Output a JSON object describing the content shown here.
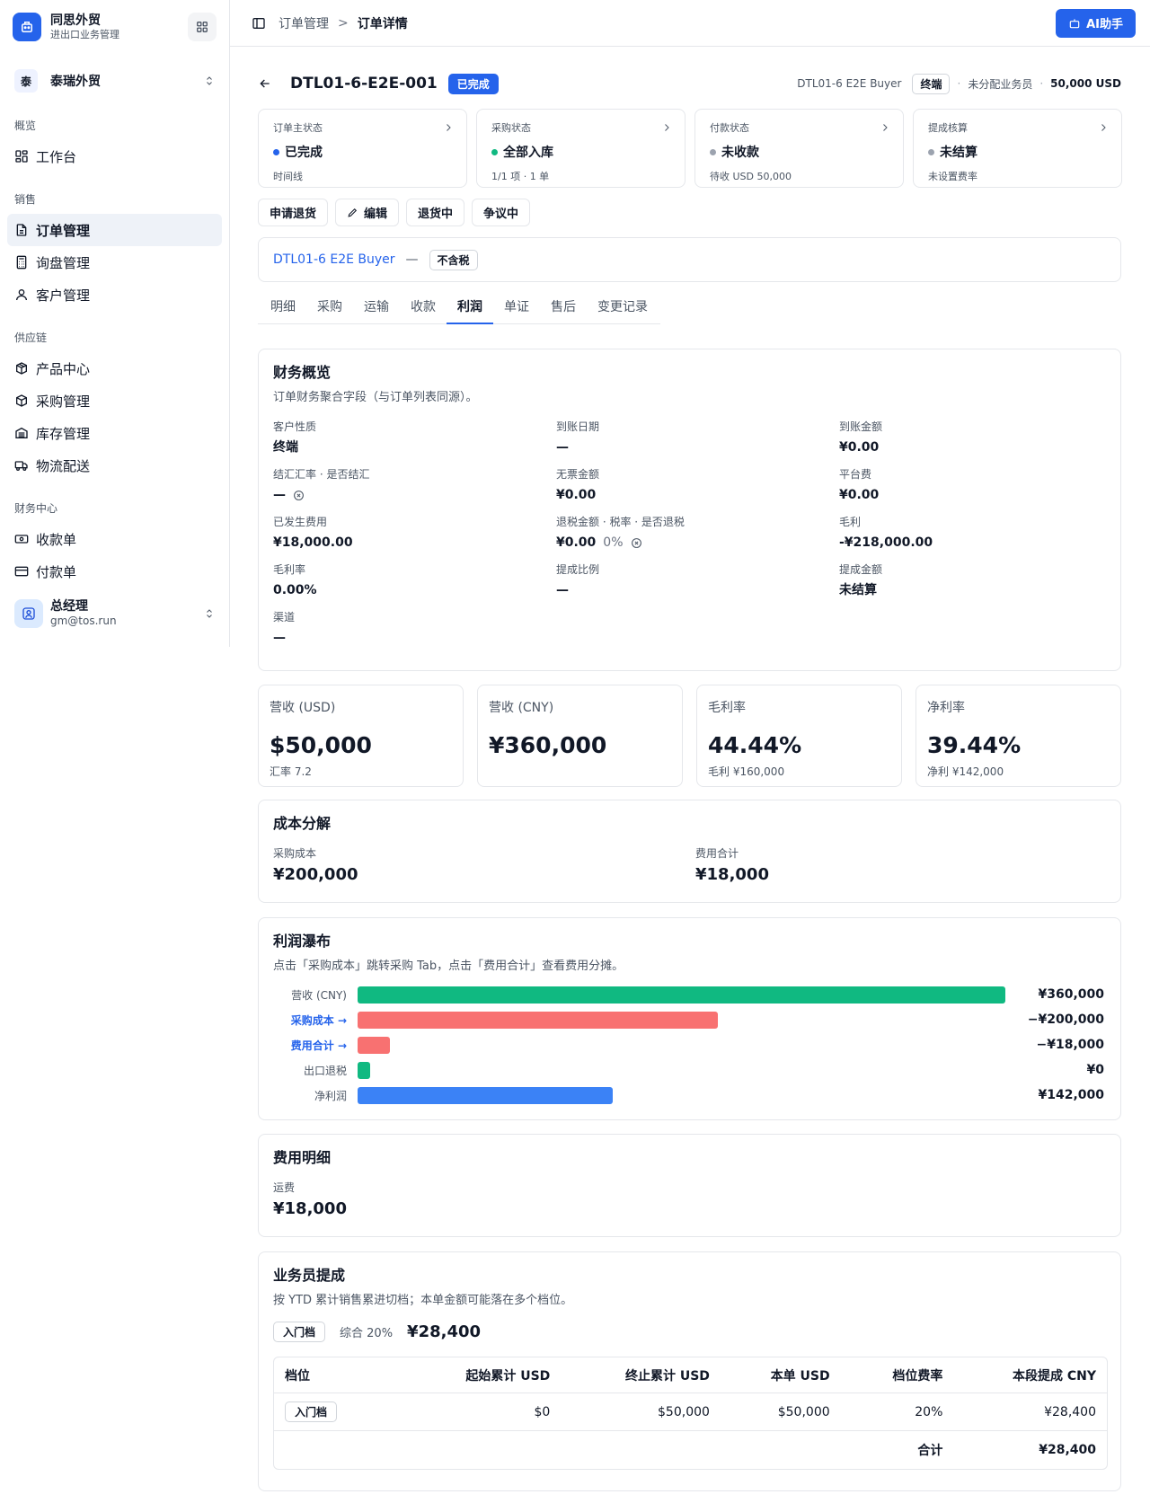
{
  "brand": {
    "name": "同思外贸",
    "subtitle": "进出口业务管理"
  },
  "org": {
    "badge": "泰",
    "name": "泰瑞外贸"
  },
  "nav": {
    "overview": {
      "label": "概览",
      "items": [
        {
          "label": "工作台"
        }
      ]
    },
    "sales": {
      "label": "销售",
      "items": [
        {
          "label": "订单管理"
        },
        {
          "label": "询盘管理"
        },
        {
          "label": "客户管理"
        }
      ]
    },
    "supply": {
      "label": "供应链",
      "items": [
        {
          "label": "产品中心"
        },
        {
          "label": "采购管理"
        },
        {
          "label": "库存管理"
        },
        {
          "label": "物流配送"
        }
      ]
    },
    "finance": {
      "label": "财务中心",
      "items": [
        {
          "label": "收款单"
        },
        {
          "label": "付款单"
        }
      ]
    }
  },
  "user": {
    "name": "总经理",
    "email": "gm@tos.run"
  },
  "topbar": {
    "crumb1": "订单管理",
    "sep": ">",
    "crumb2": "订单详情",
    "ai_label": "AI助手"
  },
  "order": {
    "code": "DTL01-6-E2E-001",
    "status": "已完成",
    "buyer": "DTL01-6 E2E Buyer",
    "customer_type": "终端",
    "sep": "·",
    "salesperson": "未分配业务员",
    "total": "50,000 USD"
  },
  "status_cards": [
    {
      "label": "订单主状态",
      "value": "已完成",
      "sub": "时间线",
      "color": "#2563eb"
    },
    {
      "label": "采购状态",
      "value": "全部入库",
      "sub": "1/1 项 · 1 单",
      "color": "#10b981"
    },
    {
      "label": "付款状态",
      "value": "未收款",
      "sub": "待收 USD 50,000",
      "color": "#9ca3af"
    },
    {
      "label": "提成核算",
      "value": "未结算",
      "sub": "未设置费率",
      "color": "#9ca3af"
    }
  ],
  "actions": {
    "refund": "申请退货",
    "edit": "编辑",
    "returning": "退货中",
    "dispute": "争议中"
  },
  "customer_bar": {
    "name": "DTL01-6 E2E Buyer",
    "dash": "—",
    "tax": "不含税"
  },
  "tabs": [
    "明细",
    "采购",
    "运输",
    "收款",
    "利润",
    "单证",
    "售后",
    "变更记录"
  ],
  "finance": {
    "title": "财务概览",
    "subtitle": "订单财务聚合字段（与订单列表同源）。",
    "fields": [
      {
        "label": "客户性质",
        "value": "终端"
      },
      {
        "label": "到账日期",
        "value": "—"
      },
      {
        "label": "到账金额",
        "value": "¥0.00"
      },
      {
        "label": "结汇汇率 · 是否结汇",
        "value": "—"
      },
      {
        "label": "无票金额",
        "value": "¥0.00"
      },
      {
        "label": "平台费",
        "value": "¥0.00"
      },
      {
        "label": "已发生费用",
        "value": "¥18,000.00"
      },
      {
        "label": "退税金额 · 税率 · 是否退税",
        "value": "¥0.00",
        "extra": "0%"
      },
      {
        "label": "毛利",
        "value": "-¥218,000.00"
      },
      {
        "label": "毛利率",
        "value": "0.00%"
      },
      {
        "label": "提成比例",
        "value": "—"
      },
      {
        "label": "提成金额",
        "value": "未结算"
      },
      {
        "label": "渠道",
        "value": "—"
      }
    ]
  },
  "kpis": [
    {
      "label": "营收 (USD)",
      "value": "$50,000",
      "sub": "汇率 7.2"
    },
    {
      "label": "营收 (CNY)",
      "value": "¥360,000",
      "sub": ""
    },
    {
      "label": "毛利率",
      "value": "44.44%",
      "sub": "毛利 ¥160,000"
    },
    {
      "label": "净利率",
      "value": "39.44%",
      "sub": "净利 ¥142,000"
    }
  ],
  "cost": {
    "title": "成本分解",
    "purchase_label": "采购成本",
    "purchase_value": "¥200,000",
    "fee_label": "费用合计",
    "fee_value": "¥18,000"
  },
  "waterfall": {
    "title": "利润瀑布",
    "subtitle": "点击「采购成本」跳转采购 Tab，点击「费用合计」查看费用分摊。",
    "max": 360000,
    "rows": [
      {
        "label": "营收 (CNY)",
        "value": 360000,
        "start": 0,
        "display": "¥360,000",
        "color": "#10b981",
        "link": false
      },
      {
        "label": "采购成本 →",
        "value": 200000,
        "start": 0,
        "display": "−¥200,000",
        "color": "#f87171",
        "link": true
      },
      {
        "label": "费用合计 →",
        "value": 18000,
        "start": 0,
        "display": "−¥18,000",
        "color": "#f87171",
        "link": true
      },
      {
        "label": "出口退税",
        "value": 0,
        "start": 0,
        "display": "¥0",
        "color": "#10b981",
        "link": false
      },
      {
        "label": "净利润",
        "value": 142000,
        "start": 0,
        "display": "¥142,000",
        "color": "#3b82f6",
        "link": false
      }
    ]
  },
  "fees": {
    "title": "费用明细",
    "label": "运费",
    "value": "¥18,000"
  },
  "commission": {
    "title": "业务员提成",
    "subtitle": "按 YTD 累计销售累进切档；本单金额可能落在多个档位。",
    "tier_tag": "入门档",
    "rate_text": "综合 20%",
    "amount": "¥28,400",
    "headers": [
      "档位",
      "起始累计 USD",
      "终止累计 USD",
      "本单 USD",
      "档位费率",
      "本段提成 CNY"
    ],
    "rows": [
      {
        "tier": "入门档",
        "start": "$0",
        "end": "$50,000",
        "order": "$50,000",
        "rate": "20%",
        "amount": "¥28,400"
      }
    ],
    "total_label": "合计",
    "total_value": "¥28,400"
  }
}
